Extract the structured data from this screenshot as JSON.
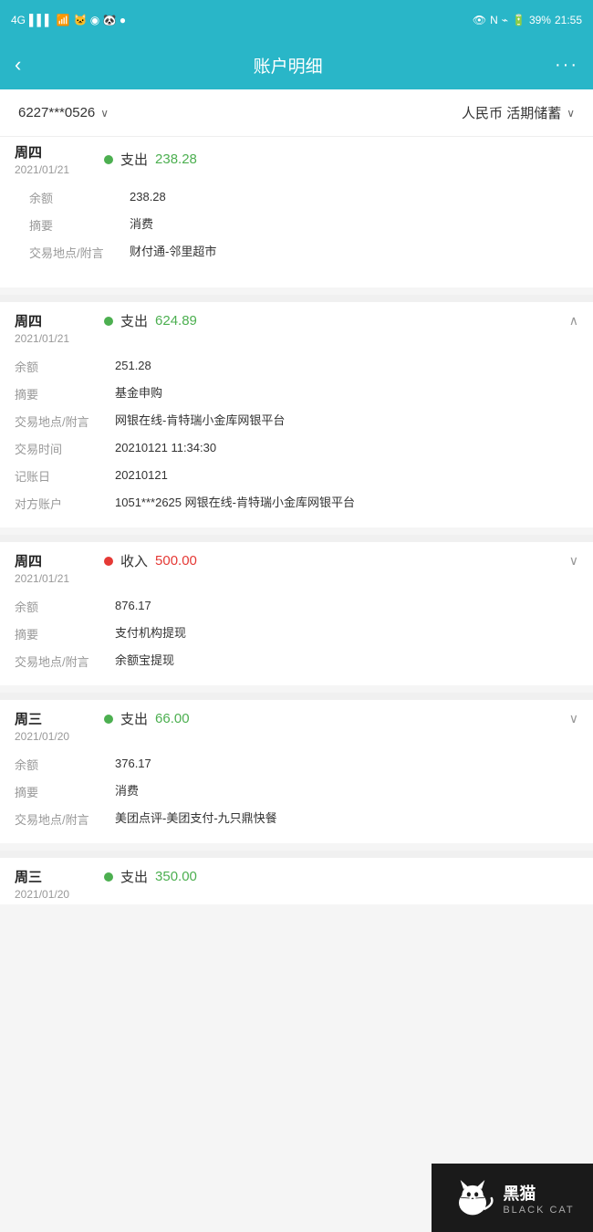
{
  "statusBar": {
    "signal": "4G",
    "time": "21:55",
    "battery": "39%"
  },
  "header": {
    "backLabel": "‹",
    "title": "账户明细",
    "moreLabel": "···"
  },
  "accountBar": {
    "accountNumber": "6227***0526",
    "chevronDown": "∨",
    "accountType": "人民币 活期储蓄",
    "chevronDown2": "∨"
  },
  "transactions": [
    {
      "day": "周四",
      "date": "2021/01/21",
      "type": "支出",
      "dotColor": "green",
      "amount": "624.89",
      "amountColor": "green",
      "expanded": true,
      "expandIcon": "∧",
      "details": [
        {
          "label": "余额",
          "value": "251.28"
        },
        {
          "label": "摘要",
          "value": "基金申购"
        },
        {
          "label": "交易地点/附言",
          "value": "网银在线-肯特瑞小金库网银平台"
        },
        {
          "label": "交易时间",
          "value": "20210121 11:34:30"
        },
        {
          "label": "记账日",
          "value": "20210121"
        },
        {
          "label": "对方账户",
          "value": "1051***2625 网银在线-肯特瑞小金库网银平台"
        }
      ]
    },
    {
      "day": "周四",
      "date": "2021/01/21",
      "type": "收入",
      "dotColor": "red",
      "amount": "500.00",
      "amountColor": "red",
      "expanded": false,
      "expandIcon": "∨",
      "details": [
        {
          "label": "余额",
          "value": "876.17"
        },
        {
          "label": "摘要",
          "value": "支付机构提现"
        },
        {
          "label": "交易地点/附言",
          "value": "余额宝提现"
        }
      ]
    },
    {
      "day": "周三",
      "date": "2021/01/20",
      "type": "支出",
      "dotColor": "green",
      "amount": "66.00",
      "amountColor": "green",
      "expanded": false,
      "expandIcon": "∨",
      "details": [
        {
          "label": "余额",
          "value": "376.17"
        },
        {
          "label": "摘要",
          "value": "消费"
        },
        {
          "label": "交易地点/附言",
          "value": "美团点评-美团支付-九只鼎快餐"
        }
      ]
    }
  ],
  "partialEntry": {
    "day": "周四",
    "date": "2021/01/21",
    "type": "支出",
    "dotColor": "green",
    "amount": "238.28",
    "amountColor": "green",
    "details": [
      {
        "label": "余额",
        "value": "238.28"
      },
      {
        "label": "摘要",
        "value": "消费"
      },
      {
        "label": "交易地点/附言",
        "value": "财付通-邻里超市"
      }
    ]
  },
  "bottomEntry": {
    "day": "周三",
    "date": "2021/01/20",
    "type": "支出",
    "dotColor": "green",
    "amount": "350.00",
    "amountColor": "green"
  },
  "watermark": {
    "chineseName": "黑猫",
    "englishName": "BLACK CAT"
  }
}
